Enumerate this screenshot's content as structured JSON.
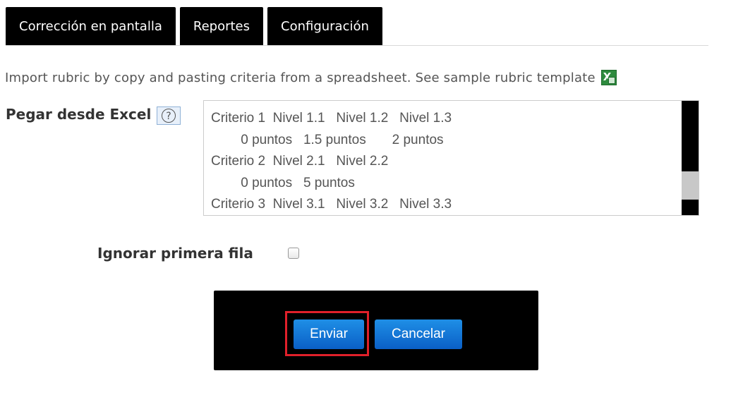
{
  "tabs": [
    {
      "label": "Corrección en pantalla"
    },
    {
      "label": "Reportes"
    },
    {
      "label": "Configuración"
    }
  ],
  "intro_text": "Import rubric by copy and pasting criteria from a spreadsheet. See sample rubric template",
  "paste_label": "Pegar desde Excel",
  "help_glyph": "?",
  "textarea_value": "Criterio 1  Nivel 1.1   Nivel 1.2   Nivel 1.3\n        0 puntos   1.5 puntos       2 puntos\nCriterio 2  Nivel 2.1   Nivel 2.2\n        0 puntos   5 puntos\nCriterio 3  Nivel 3.1   Nivel 3.2   Nivel 3.3",
  "ignore_first_row_label": "Ignorar primera fila",
  "ignore_first_row_checked": false,
  "buttons": {
    "send": "Enviar",
    "cancel": "Cancelar"
  },
  "colors": {
    "tab_bg": "#000000",
    "button_blue": "#0a6fd6",
    "highlight_red": "#e0202a"
  }
}
